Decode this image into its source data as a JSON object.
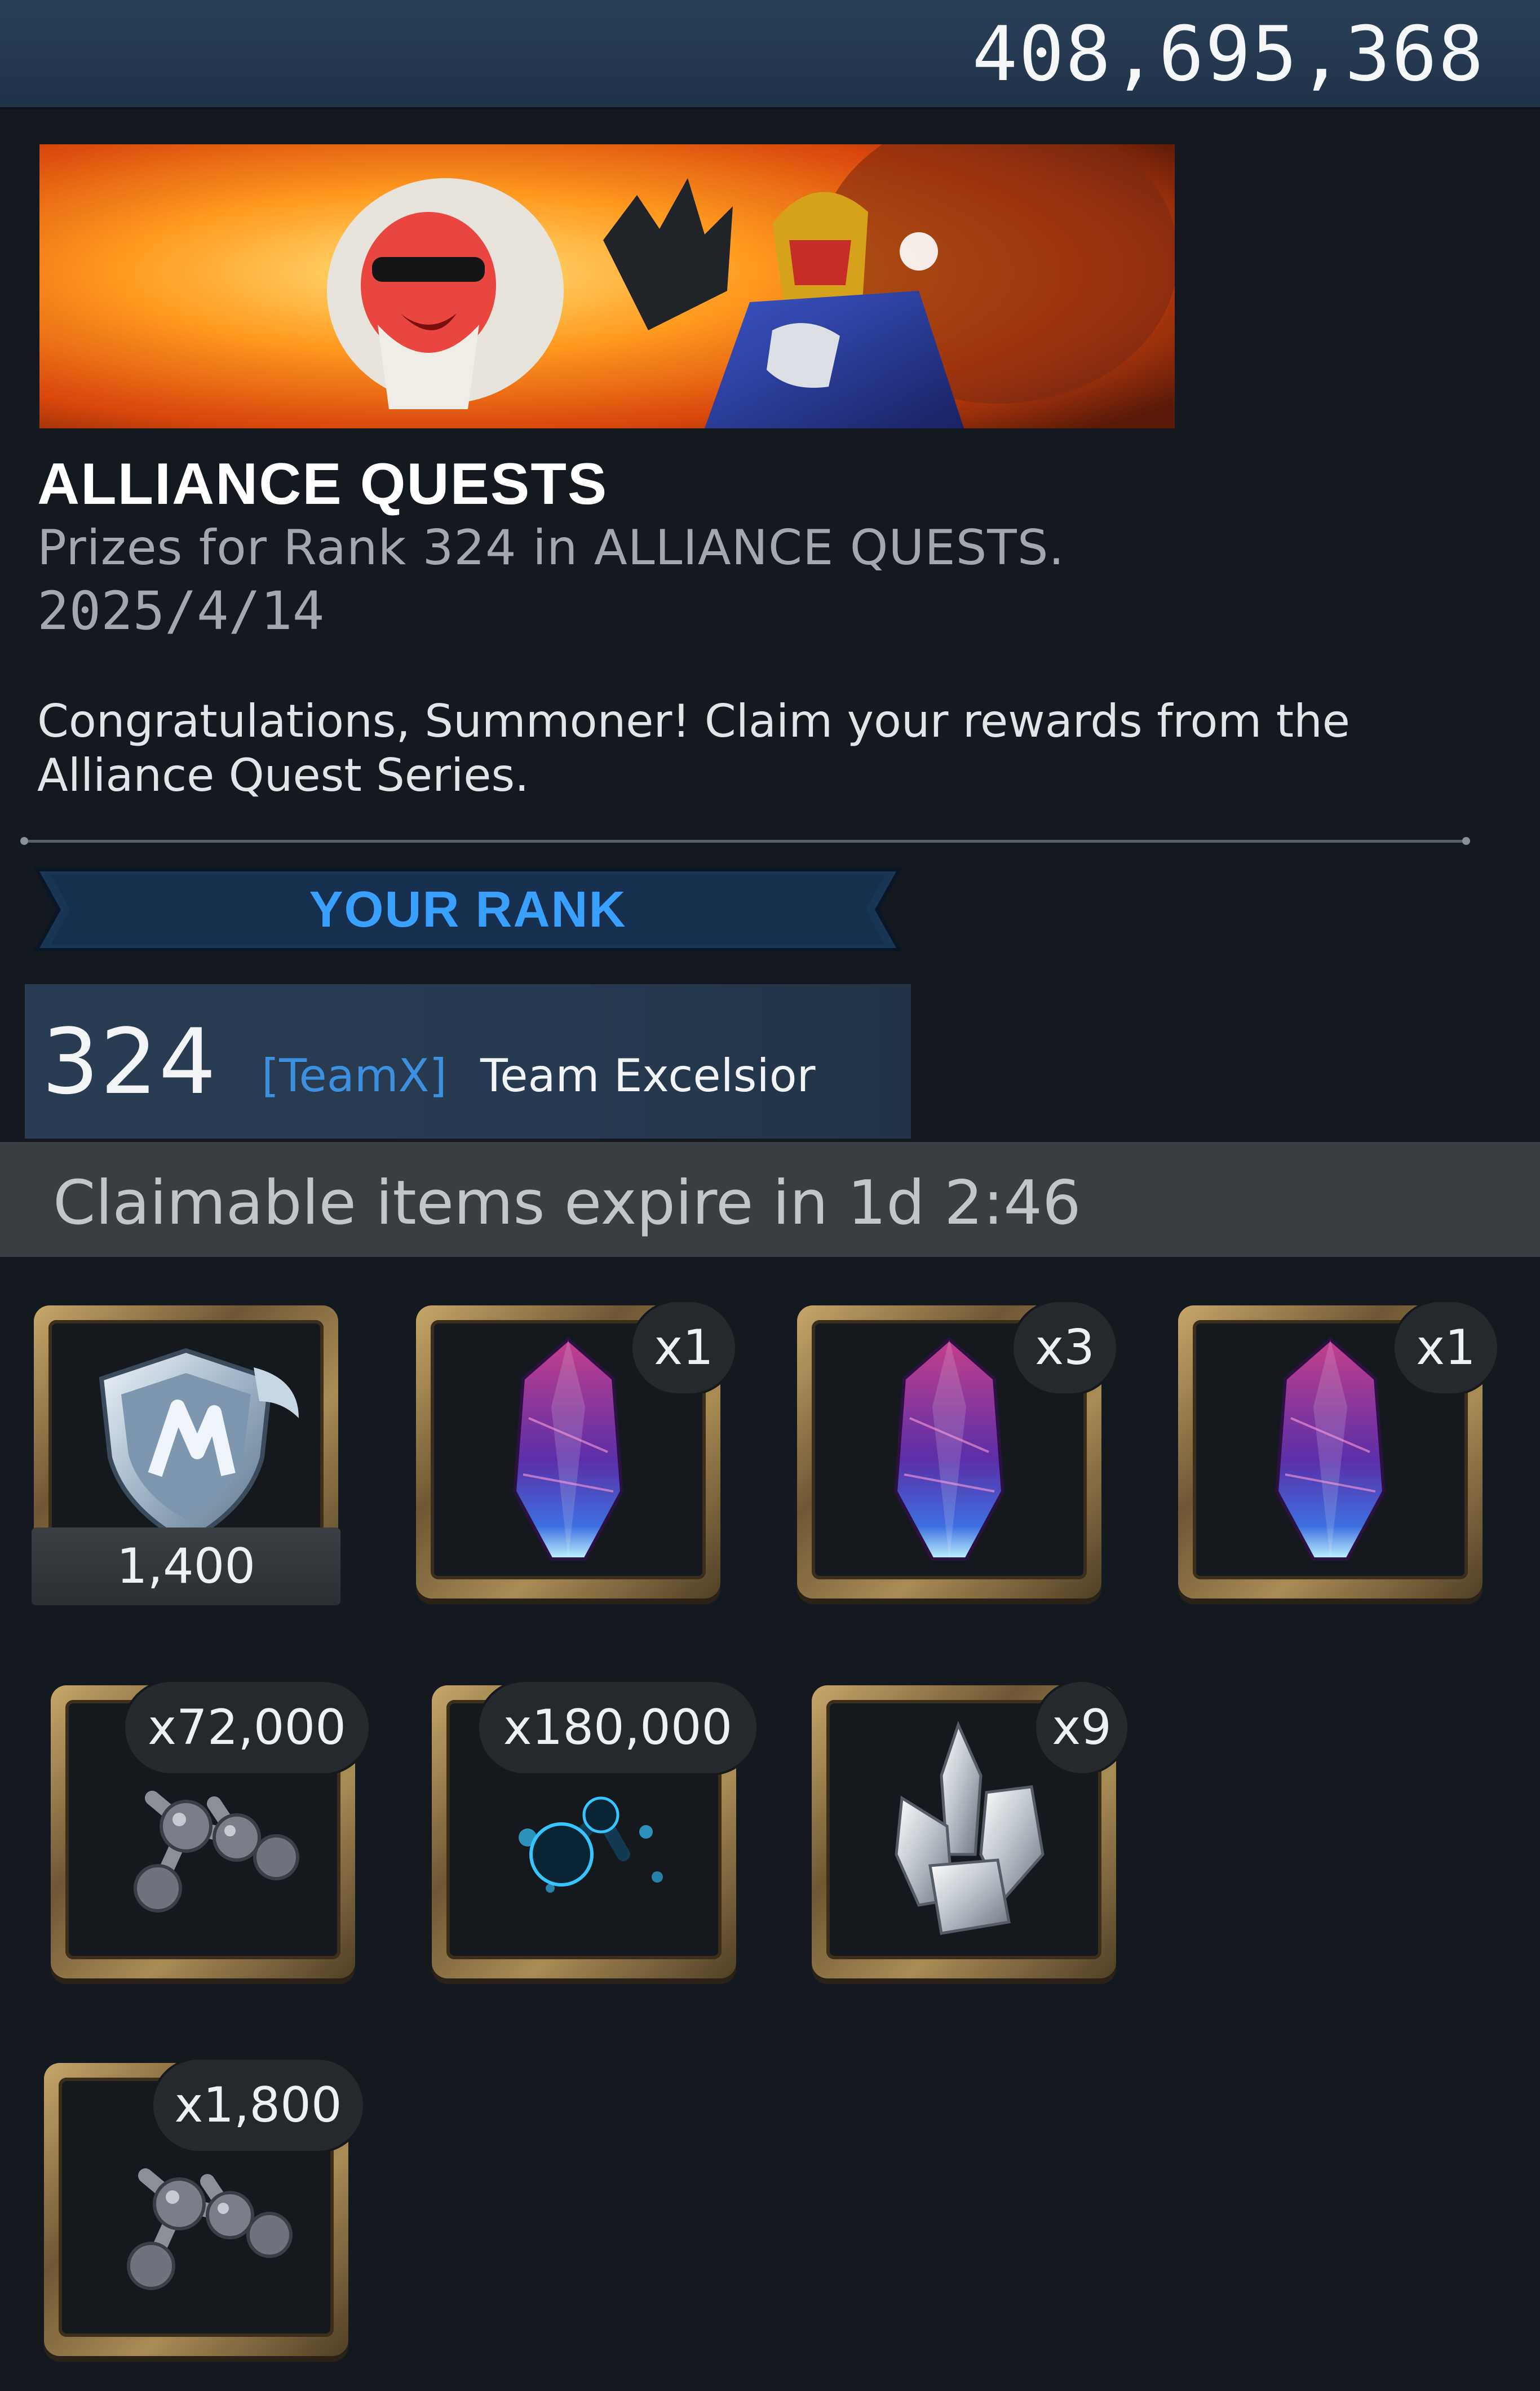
{
  "header": {
    "units_balance": "408,695,368"
  },
  "event": {
    "title": "ALLIANCE QUESTS",
    "subtitle": "Prizes for Rank 324 in ALLIANCE QUESTS.",
    "date": "2025/4/14",
    "message": "Congratulations, Summoner! Claim your rewards from the Alliance Quest Series."
  },
  "rank": {
    "section_label": "YOUR RANK",
    "value": "324",
    "alliance_tag": "[TeamX]",
    "alliance_name": "Team Excelsior"
  },
  "expiry": {
    "text": "Claimable items expire in 1d 2:46"
  },
  "rewards": [
    {
      "icon": "glory-shield-icon",
      "label": "1,400"
    },
    {
      "icon": "crystal-shard-icon",
      "qty": "x1"
    },
    {
      "icon": "crystal-shard-icon",
      "qty": "x3"
    },
    {
      "icon": "crystal-shard-icon",
      "qty": "x1"
    },
    {
      "icon": "molecule-catalyst-gray-icon",
      "qty": "x72,000"
    },
    {
      "icon": "molecule-catalyst-blue-icon",
      "qty": "x180,000"
    },
    {
      "icon": "clear-crystal-cluster-icon",
      "qty": "x9"
    },
    {
      "icon": "molecule-catalyst-gray-icon",
      "qty": "x1,800"
    }
  ],
  "colors": {
    "background": "#141920",
    "topbar": "#223549",
    "rank_label": "#3aa0ff",
    "alliance_tag": "#3d8fe0",
    "frame_gold": "#a98c55"
  }
}
